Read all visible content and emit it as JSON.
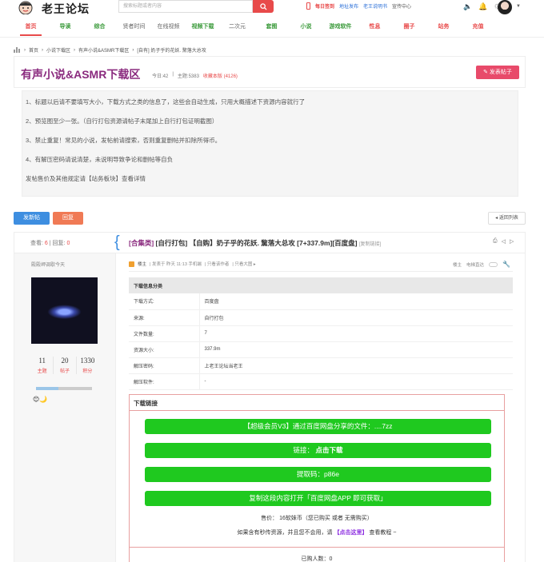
{
  "header": {
    "site_name": "老王论坛",
    "search_placeholder": "搜索标题或者内容",
    "links": [
      "每日签到",
      "地址发布",
      "老王说明书",
      "宣传中心"
    ]
  },
  "nav": [
    "首页",
    "导读",
    "综合",
    "贤者时间",
    "在线视频",
    "视频下载",
    "二次元",
    "套图",
    "小说",
    "游戏软件",
    "性息",
    "圈子",
    "站务",
    "充值"
  ],
  "breadcrumb": [
    "首页",
    "小说下载区",
    "有声小说&ASMR下载区",
    "[自有] 奶子乎的花妖. 黧落大总攻"
  ],
  "forum": {
    "title": "有声小说&ASMR下载区",
    "today": "今日:42",
    "topics": "主题:5383",
    "fav": "收藏本版 (4126)",
    "new_post": "发表帖子"
  },
  "rules": [
    "1、标题以后请不要填写大小，下载方式之类的信息了，这些会自动生成，只用大概描述下资源内容就行了",
    "2、预览图至少一张。（自行打包资源请帖子末尾加上自行打包证明截图）",
    "3、禁止重复！常见的小说，发帖前请搜索，否则重复删帖并扣除所得币。",
    "4、有解压密码请说清楚，未说明导致争论和删帖等自负",
    "发帖售价及其他规定请【站务板块】查看详情"
  ],
  "actions": {
    "new_post": "发新帖",
    "reply": "回复",
    "back": "◂ 返回列表"
  },
  "thread": {
    "views_label": "查看:",
    "views": "6",
    "replies_label": "| 回复:",
    "replies": "0",
    "tag": "[合集类]",
    "title": "[自行打包] 【自购】奶子乎的花妖. 黧落大总攻 [7+337.9m][百度盘]",
    "copy": "[复制链接]"
  },
  "user": {
    "sign": "殿殿岬调歇今天",
    "stats": [
      {
        "n": "11",
        "l": "主题"
      },
      {
        "n": "20",
        "l": "帖子"
      },
      {
        "n": "1330",
        "l": "积分"
      }
    ],
    "level_fraction": 0.4
  },
  "post_meta": {
    "role": "楼主",
    "time": "| 发表于 昨天 11:13 手机端",
    "only_author": "| 只看该作者",
    "only_big": "| 只看大图 ▸",
    "floor": "楼主",
    "read_mode": "电梯直达"
  },
  "info": {
    "heading": "下载信息分类",
    "rows": [
      {
        "k": "下载方式:",
        "v": "百度盘"
      },
      {
        "k": "来源:",
        "v": "自行打包"
      },
      {
        "k": "文件数量:",
        "v": "7"
      },
      {
        "k": "资源大小:",
        "v": "337.9m"
      },
      {
        "k": "解压密码:",
        "v": "上老王论坛当老王"
      },
      {
        "k": "解压软件:",
        "v": "-"
      }
    ]
  },
  "download": {
    "heading": "下载链接",
    "b1": "【超级会员V3】通过百度网盘分享的文件：....7zz",
    "b2_pre": "链接：",
    "b2": "点击下载",
    "b3": "提取码：p86e",
    "b4": "复制这段内容打开「百度网盘APP 即可获取」",
    "price": "售价：  16软妹币（您已购买 或者 无需购买）",
    "note_pre": "如果含有秒传资源，并且您不会用，请",
    "note_link": "【点击这里】",
    "note_post": "查看教程 ~",
    "bought": "已购人数：0"
  }
}
